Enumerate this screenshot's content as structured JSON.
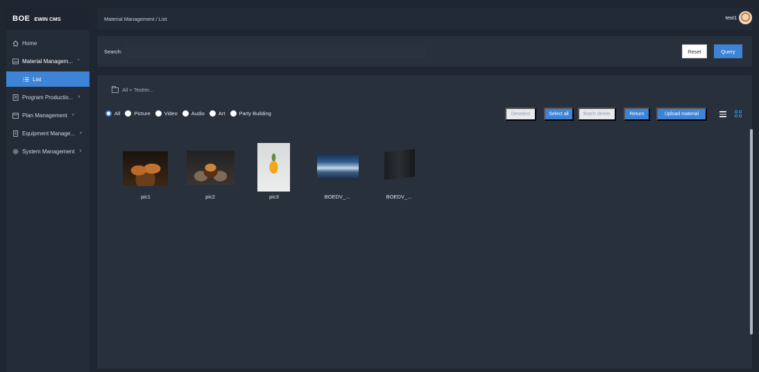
{
  "app": {
    "brand": "BOE",
    "product": "EWIN CMS"
  },
  "sidebar": {
    "items": [
      {
        "label": "Home",
        "icon": "home-icon"
      },
      {
        "label": "Material Managem...",
        "icon": "image-icon",
        "chevron": "^"
      },
      {
        "label": "List",
        "icon": "list-icon"
      },
      {
        "label": "Program Productio...",
        "icon": "document-icon",
        "chevron": "v"
      },
      {
        "label": "Plan Management",
        "icon": "calendar-icon",
        "chevron": "v"
      },
      {
        "label": "Equipment Manage...",
        "icon": "device-icon",
        "chevron": "v"
      },
      {
        "label": "System Management",
        "icon": "gear-icon",
        "chevron": "v"
      }
    ]
  },
  "header": {
    "breadcrumb": "Material Management / List",
    "username": "test1"
  },
  "search": {
    "label": "Search:",
    "value": "",
    "reset_label": "Reset",
    "query_label": "Query"
  },
  "folder": {
    "path": "All > TestIm..."
  },
  "filters": [
    {
      "label": "All",
      "checked": true
    },
    {
      "label": "Picture",
      "checked": false
    },
    {
      "label": "Video",
      "checked": false
    },
    {
      "label": "Audio",
      "checked": false
    },
    {
      "label": "Art",
      "checked": false
    },
    {
      "label": "Party Building",
      "checked": false
    }
  ],
  "actions": {
    "deselect": "Deselect",
    "select_all": "Select all",
    "batch_delete": "Batch delete",
    "return": "Return",
    "upload": "Upload material"
  },
  "materials": [
    {
      "label": "pic1",
      "thumb": "burger-image"
    },
    {
      "label": "pic2",
      "thumb": "burger-image"
    },
    {
      "label": "pic3",
      "thumb": "drink-image"
    },
    {
      "label": "BOEDV_...",
      "thumb": "display-screen-image"
    },
    {
      "label": "BOEDV_...",
      "thumb": "tv-panel-image"
    }
  ],
  "colors": {
    "accent": "#3d84d6",
    "background": "#1f2630",
    "panel": "#28303c"
  }
}
